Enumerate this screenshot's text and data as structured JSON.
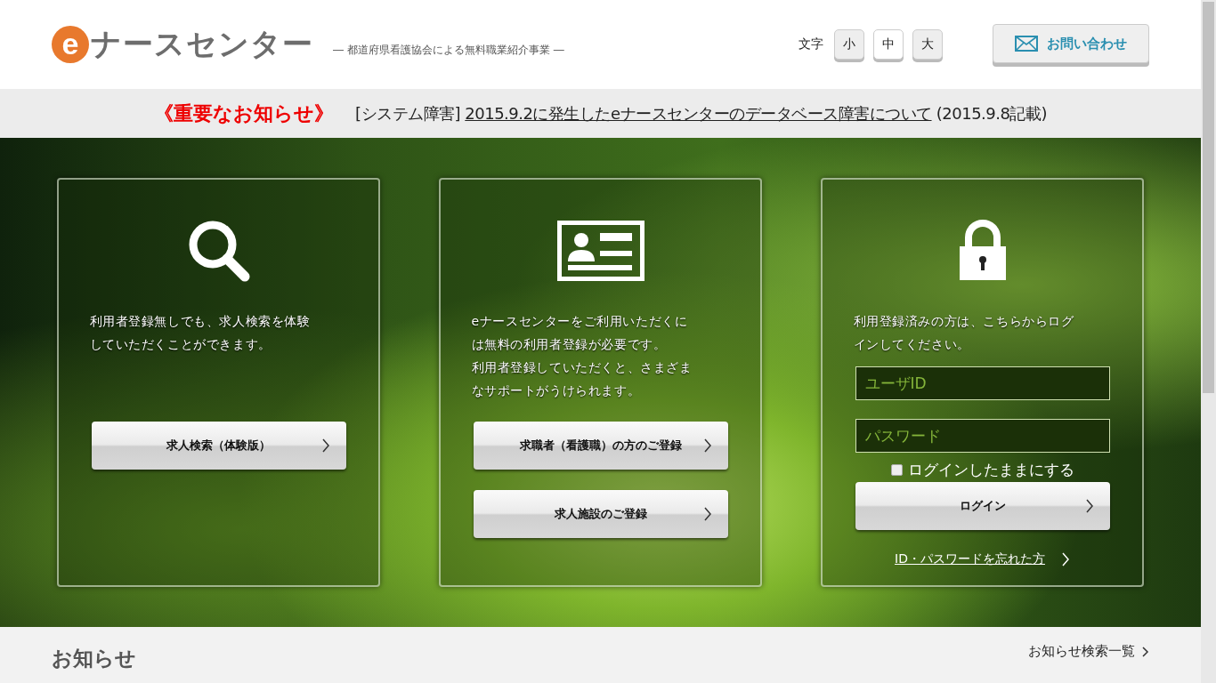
{
  "header": {
    "logo_mark": "e",
    "logo_text": "ナースセンター",
    "tagline": "― 都道府県看護協会による無料職業紹介事業 ―",
    "font_size": {
      "label": "文字",
      "options": [
        {
          "label": "小",
          "selected": false
        },
        {
          "label": "中",
          "selected": true
        },
        {
          "label": "大",
          "selected": false
        }
      ]
    },
    "contact_button": "お問い合わせ"
  },
  "notice": {
    "label": "《重要なお知らせ》",
    "category": "[システム障害]",
    "link": "2015.9.2に発生したeナースセンターのデータベース障害について",
    "date": "(2015.9.8記載)"
  },
  "cards": [
    {
      "kind": "search",
      "lines": [
        "利用者登録無しでも、求人検索を体験",
        "していただくことができます。"
      ],
      "buttons": [
        "求人検索（体験版）"
      ]
    },
    {
      "kind": "register",
      "lines": [
        "eナースセンターをご利用いただくに",
        "は無料の利用者登録が必要です。",
        "利用者登録していただくと、さまざま",
        "なサポートがうけられます。"
      ],
      "buttons": [
        "求職者（看護職）の方のご登録",
        "求人施設のご登録"
      ]
    },
    {
      "kind": "login",
      "lines": [
        "利用登録済みの方は、こちらからログ",
        "インしてください。"
      ],
      "user_placeholder": "ユーザID",
      "password_placeholder": "パスワード",
      "remember": {
        "label": "ログインしたままにする",
        "checked": false
      },
      "buttons": [
        "ログイン"
      ],
      "forgot_link": "ID・パスワードを忘れた方"
    }
  ],
  "news": {
    "title": "お知らせ",
    "list_link": "お知らせ検索一覧"
  }
}
